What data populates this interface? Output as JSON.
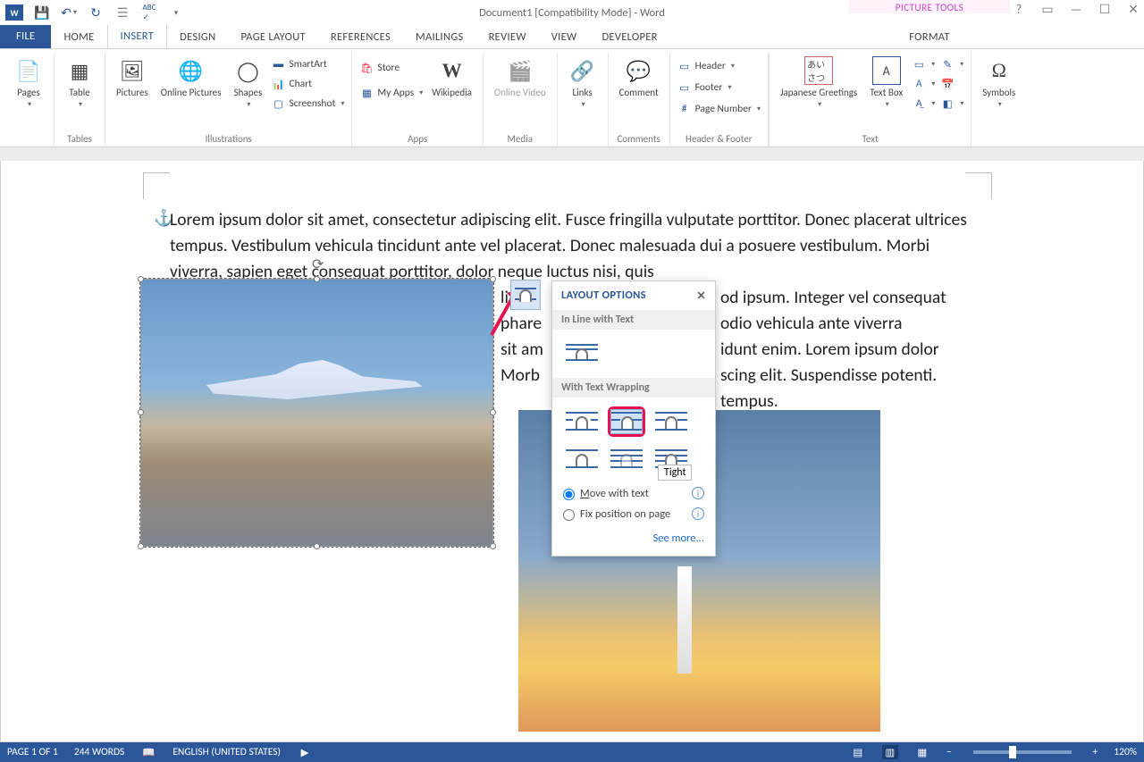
{
  "title": "Document1 [Compatibility Mode] - Word",
  "picture_tools_label": "PICTURE TOOLS",
  "tabs": {
    "file": "FILE",
    "home": "HOME",
    "insert": "INSERT",
    "design": "DESIGN",
    "pagelayout": "PAGE LAYOUT",
    "references": "REFERENCES",
    "mailings": "MAILINGS",
    "review": "REVIEW",
    "view": "VIEW",
    "developer": "DEVELOPER",
    "format": "FORMAT"
  },
  "ribbon": {
    "pages": "Pages",
    "tables_group": "Tables",
    "table": "Table",
    "pictures": "Pictures",
    "online_pictures": "Online Pictures",
    "shapes": "Shapes",
    "smartart": "SmartArt",
    "chart": "Chart",
    "screenshot": "Screenshot",
    "illustrations_group": "Illustrations",
    "store": "Store",
    "myapps": "My Apps",
    "wikipedia": "Wikipedia",
    "apps_group": "Apps",
    "online_video": "Online Video",
    "media_group": "Media",
    "links": "Links",
    "comment": "Comment",
    "comments_group": "Comments",
    "header": "Header",
    "footer": "Footer",
    "page_number": "Page Number",
    "hf_group": "Header & Footer",
    "japanese_greetings": "Japanese Greetings",
    "text_box": "Text Box",
    "text_group": "Text",
    "symbols": "Symbols"
  },
  "document_text": "Lorem ipsum dolor sit amet, consectetur adipiscing elit. Fusce fringilla vulputate porttitor. Donec placerat ultrices tempus. Vestibulum vehicula tincidunt ante vel placerat. Donec malesuada dui a posuere vestibulum. Morbi viverra, sapien eget consequat porttitor, dolor neque luctus nisi, quis",
  "right_frag1": "od ipsum. Integer vel consequat",
  "right_frag2": "odio vehicula ante viverra",
  "right_frag3": "idunt enim. Lorem ipsum dolor",
  "right_frag4": "scing elit. Suspendisse potenti.",
  "right_frag5": "tempus.",
  "left_frag1": "lit. P",
  "left_frag2": "phare",
  "left_frag3": "sit am",
  "left_frag4": "Morb",
  "layout": {
    "title": "LAYOUT OPTIONS",
    "inline": "In Line with Text",
    "wrapping": "With Text Wrapping",
    "tight_tooltip": "Tight",
    "move": "Move with text",
    "fix": "Fix position on page",
    "seemore": "See more..."
  },
  "status": {
    "page": "PAGE 1 OF 1",
    "words": "244 WORDS",
    "lang": "ENGLISH (UNITED STATES)",
    "zoom": "120%"
  }
}
